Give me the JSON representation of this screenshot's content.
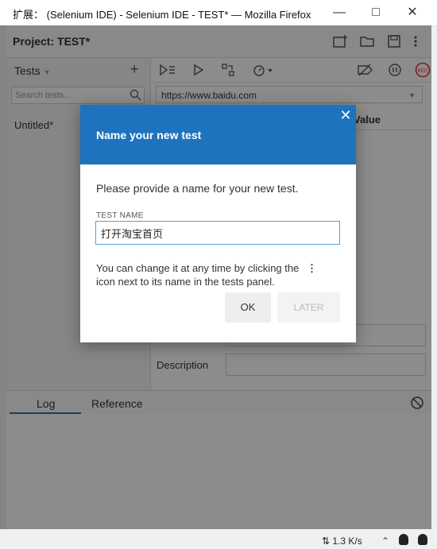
{
  "window": {
    "title": "扩展：  (Selenium IDE) - Selenium IDE - TEST* — Mozilla Firefox",
    "minimize_icon": "minimize-icon",
    "maximize_icon": "maximize-icon",
    "close_icon": "close-icon"
  },
  "project": {
    "label": "Project:",
    "name": "TEST*"
  },
  "sidebar": {
    "header": "Tests",
    "search_placeholder": "Search tests...",
    "items": [
      {
        "label": "Untitled*"
      }
    ]
  },
  "main": {
    "url": "https://www.baidu.com",
    "value_column": "Value",
    "description_label": "Description"
  },
  "bottom": {
    "tabs": [
      {
        "label": "Log"
      },
      {
        "label": "Reference"
      }
    ]
  },
  "dialog": {
    "title": "Name your new test",
    "description": "Please provide a name for your new test.",
    "field_label": "TEST NAME",
    "field_value": "打开淘宝首页",
    "hint": "You can change it at any time by clicking the",
    "hint_2": "icon next to its name in the tests panel.",
    "ok_label": "OK",
    "later_label": "LATER"
  },
  "status": {
    "speed": "1.3 K/s"
  },
  "colors": {
    "accent": "#1e73be",
    "record": "#e53935"
  }
}
